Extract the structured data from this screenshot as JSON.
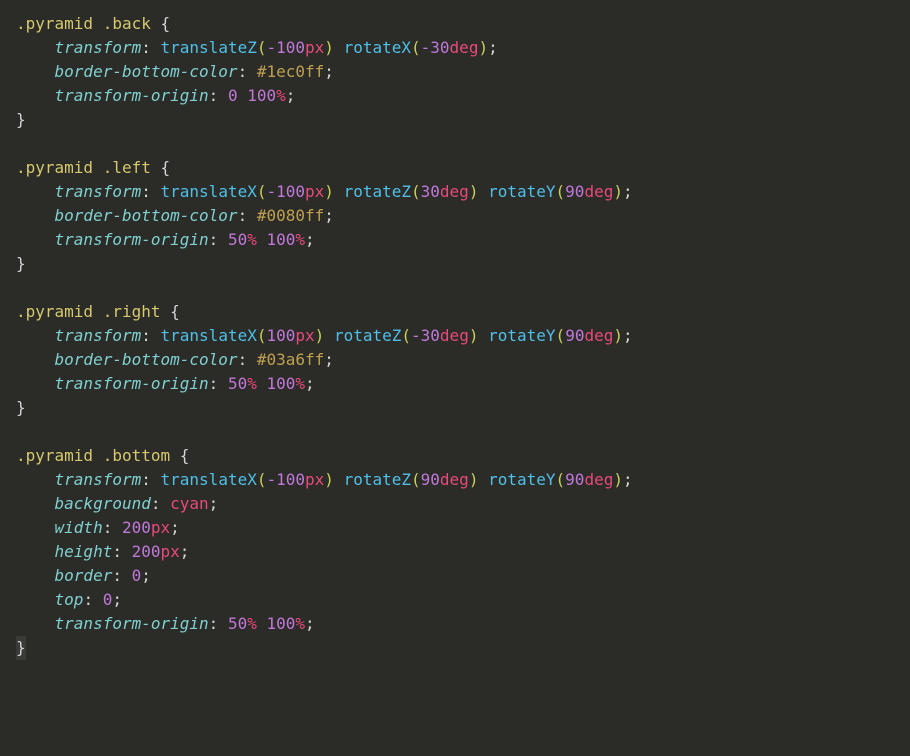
{
  "code": {
    "rules": [
      {
        "selector": [
          ".pyramid",
          ".back"
        ],
        "declarations": [
          {
            "prop": "transform",
            "value": [
              {
                "t": "func",
                "name": "translateZ",
                "args": [
                  {
                    "t": "num",
                    "v": "-100",
                    "u": "px"
                  }
                ]
              },
              {
                "t": "sp"
              },
              {
                "t": "func",
                "name": "rotateX",
                "args": [
                  {
                    "t": "num",
                    "v": "-30",
                    "u": "deg"
                  }
                ]
              }
            ]
          },
          {
            "prop": "border-bottom-color",
            "value": [
              {
                "t": "hex",
                "v": "#1ec0ff"
              }
            ]
          },
          {
            "prop": "transform-origin",
            "value": [
              {
                "t": "num",
                "v": "0"
              },
              {
                "t": "sp"
              },
              {
                "t": "num",
                "v": "100",
                "u": "%"
              }
            ]
          }
        ]
      },
      {
        "selector": [
          ".pyramid",
          ".left"
        ],
        "declarations": [
          {
            "prop": "transform",
            "value": [
              {
                "t": "func",
                "name": "translateX",
                "args": [
                  {
                    "t": "num",
                    "v": "-100",
                    "u": "px"
                  }
                ]
              },
              {
                "t": "sp"
              },
              {
                "t": "func",
                "name": "rotateZ",
                "args": [
                  {
                    "t": "num",
                    "v": "30",
                    "u": "deg"
                  }
                ]
              },
              {
                "t": "sp"
              },
              {
                "t": "func",
                "name": "rotateY",
                "args": [
                  {
                    "t": "num",
                    "v": "90",
                    "u": "deg"
                  }
                ]
              }
            ]
          },
          {
            "prop": "border-bottom-color",
            "value": [
              {
                "t": "hex",
                "v": "#0080ff"
              }
            ]
          },
          {
            "prop": "transform-origin",
            "value": [
              {
                "t": "num",
                "v": "50",
                "u": "%"
              },
              {
                "t": "sp"
              },
              {
                "t": "num",
                "v": "100",
                "u": "%"
              }
            ]
          }
        ]
      },
      {
        "selector": [
          ".pyramid",
          ".right"
        ],
        "declarations": [
          {
            "prop": "transform",
            "value": [
              {
                "t": "func",
                "name": "translateX",
                "args": [
                  {
                    "t": "num",
                    "v": "100",
                    "u": "px"
                  }
                ]
              },
              {
                "t": "sp"
              },
              {
                "t": "func",
                "name": "rotateZ",
                "args": [
                  {
                    "t": "num",
                    "v": "-30",
                    "u": "deg"
                  }
                ]
              },
              {
                "t": "sp"
              },
              {
                "t": "func",
                "name": "rotateY",
                "args": [
                  {
                    "t": "num",
                    "v": "90",
                    "u": "deg"
                  }
                ]
              }
            ]
          },
          {
            "prop": "border-bottom-color",
            "value": [
              {
                "t": "hex",
                "v": "#03a6ff"
              }
            ]
          },
          {
            "prop": "transform-origin",
            "value": [
              {
                "t": "num",
                "v": "50",
                "u": "%"
              },
              {
                "t": "sp"
              },
              {
                "t": "num",
                "v": "100",
                "u": "%"
              }
            ]
          }
        ]
      },
      {
        "selector": [
          ".pyramid",
          ".bottom"
        ],
        "declarations": [
          {
            "prop": "transform",
            "value": [
              {
                "t": "func",
                "name": "translateX",
                "args": [
                  {
                    "t": "num",
                    "v": "-100",
                    "u": "px"
                  }
                ]
              },
              {
                "t": "sp"
              },
              {
                "t": "func",
                "name": "rotateZ",
                "args": [
                  {
                    "t": "num",
                    "v": "90",
                    "u": "deg"
                  }
                ]
              },
              {
                "t": "sp"
              },
              {
                "t": "func",
                "name": "rotateY",
                "args": [
                  {
                    "t": "num",
                    "v": "90",
                    "u": "deg"
                  }
                ]
              }
            ]
          },
          {
            "prop": "background",
            "value": [
              {
                "t": "kw",
                "v": "cyan"
              }
            ]
          },
          {
            "prop": "width",
            "value": [
              {
                "t": "num",
                "v": "200",
                "u": "px"
              }
            ]
          },
          {
            "prop": "height",
            "value": [
              {
                "t": "num",
                "v": "200",
                "u": "px"
              }
            ]
          },
          {
            "prop": "border",
            "value": [
              {
                "t": "num",
                "v": "0"
              }
            ]
          },
          {
            "prop": "top",
            "value": [
              {
                "t": "num",
                "v": "0"
              }
            ]
          },
          {
            "prop": "transform-origin",
            "value": [
              {
                "t": "num",
                "v": "50",
                "u": "%"
              },
              {
                "t": "sp"
              },
              {
                "t": "num",
                "v": "100",
                "u": "%"
              }
            ]
          }
        ],
        "cursorOnClose": true
      }
    ]
  }
}
